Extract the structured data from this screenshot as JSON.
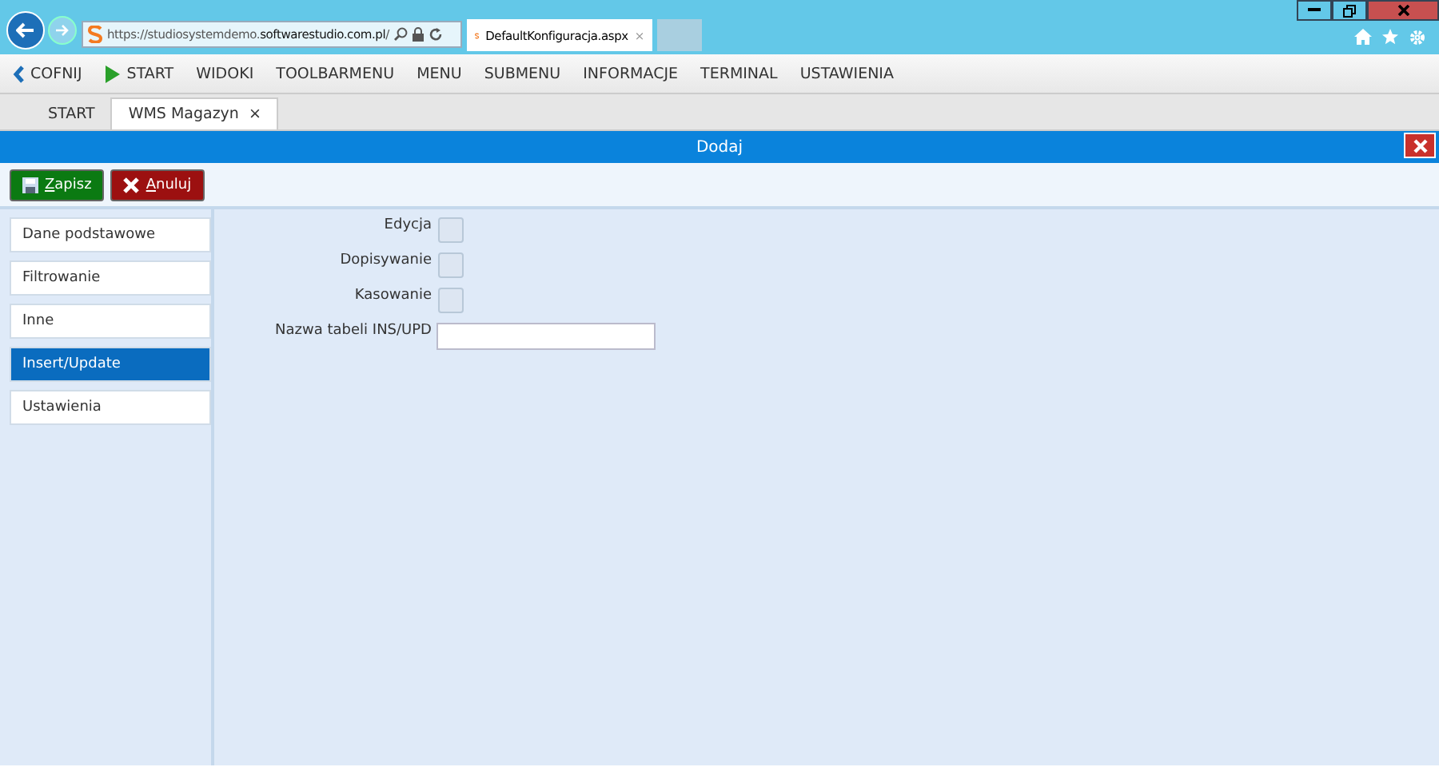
{
  "browser": {
    "address": "https://studiosystemdemo.**softwarestudio.com.pl**/",
    "tabs": [
      {
        "title": "DefaultKonfiguracja.aspx",
        "close": "×",
        "selected": true
      }
    ]
  },
  "menu": [
    {
      "label": "COFNIJ",
      "kind": "back"
    },
    {
      "label": "START",
      "kind": "play"
    },
    {
      "label": "WIDOKI",
      "kind": "plain"
    },
    {
      "label": "TOOLBARMENU",
      "kind": "plain"
    },
    {
      "label": "MENU",
      "kind": "plain"
    },
    {
      "label": "SUBMENU",
      "kind": "plain"
    },
    {
      "label": "INFORMACJE",
      "kind": "plain"
    },
    {
      "label": "TERMINAL",
      "kind": "plain"
    },
    {
      "label": "USTAWIENIA",
      "kind": "plain"
    }
  ],
  "app_tabs": [
    {
      "label": "START",
      "selected": false
    },
    {
      "label": "WMS Magazyn",
      "close": "×",
      "selected": true
    }
  ],
  "dialog": {
    "title": "Dodaj",
    "buttons": [
      {
        "label": "Zapisz",
        "kind": "save",
        "access_key_underlined": true
      },
      {
        "label": "Anuluj",
        "kind": "cancel",
        "access_key_underlined": true
      }
    ],
    "sections": [
      {
        "label": "Dane podstawowe",
        "selected": false
      },
      {
        "label": "Filtrowanie",
        "selected": false
      },
      {
        "label": "Inne",
        "selected": false
      },
      {
        "label": "Insert/Update",
        "selected": true
      },
      {
        "label": "Ustawienia",
        "selected": false
      }
    ],
    "fields": [
      {
        "label": "Edycja",
        "kind": "checkbox",
        "checked": false
      },
      {
        "label": "Dopisywanie",
        "kind": "checkbox",
        "checked": false
      },
      {
        "label": "Kasowanie",
        "kind": "checkbox",
        "checked": false
      },
      {
        "label": "Nazwa tabeli INS/UPD",
        "kind": "text"
      }
    ]
  }
}
